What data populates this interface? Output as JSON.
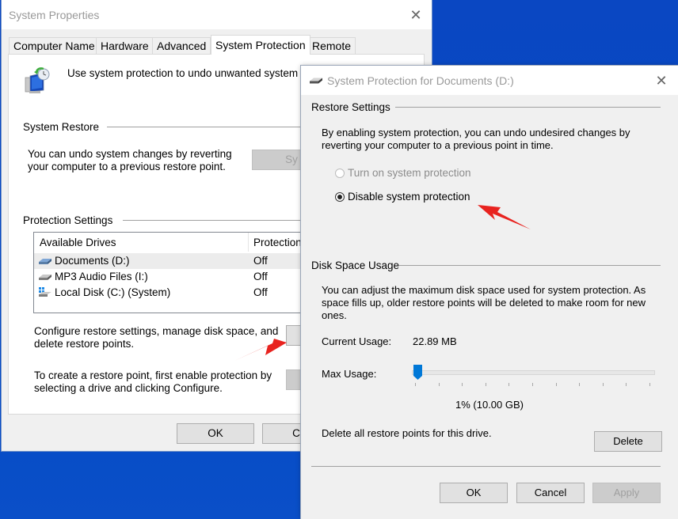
{
  "main_window": {
    "title": "System Properties",
    "close_icon": "close-icon",
    "tabs": [
      {
        "label": "Computer Name",
        "active": false
      },
      {
        "label": "Hardware",
        "active": false
      },
      {
        "label": "Advanced",
        "active": false
      },
      {
        "label": "System Protection",
        "active": true
      },
      {
        "label": "Remote",
        "active": false
      }
    ],
    "intro_icon": "system-restore-icon",
    "intro_text": "Use system protection to undo unwanted system c",
    "system_restore": {
      "group_label": "System Restore",
      "description": "You can undo system changes by reverting your computer to a previous restore point.",
      "button_label": "Sy"
    },
    "protection_settings": {
      "group_label": "Protection Settings",
      "columns": [
        "Available Drives",
        "Protection"
      ],
      "drives": [
        {
          "name": "Documents (D:)",
          "protection": "Off",
          "icon": "drive-icon",
          "selected": true
        },
        {
          "name": "MP3 Audio Files (I:)",
          "protection": "Off",
          "icon": "drive-icon",
          "selected": false
        },
        {
          "name": "Local Disk (C:) (System)",
          "protection": "Off",
          "icon": "system-drive-icon",
          "selected": false
        }
      ],
      "configure_text": "Configure restore settings, manage disk space, and delete restore points.",
      "create_text": "To create a restore point, first enable protection by selecting a drive and clicking Configure."
    },
    "ok_label": "OK",
    "cancel_label": "Car"
  },
  "dialog": {
    "title": "System Protection for Documents (D:)",
    "title_icon": "drive-icon",
    "restore_settings": {
      "group_label": "Restore Settings",
      "description": "By enabling system protection, you can undo undesired changes by reverting your computer to a previous point in time.",
      "options": [
        {
          "label": "Turn on system protection",
          "selected": false,
          "enabled": false
        },
        {
          "label": "Disable system protection",
          "selected": true,
          "enabled": true
        }
      ]
    },
    "disk_space": {
      "group_label": "Disk Space Usage",
      "description": "You can adjust the maximum disk space used for system protection. As space fills up, older restore points will be deleted to make room for new ones.",
      "current_usage_label": "Current Usage:",
      "current_usage_value": "22.89 MB",
      "max_usage_label": "Max Usage:",
      "max_usage_percent": 1,
      "max_usage_text": "1% (10.00 GB)",
      "tick_count": 11,
      "delete_text": "Delete all restore points for this drive.",
      "delete_label": "Delete"
    },
    "ok_label": "OK",
    "cancel_label": "Cancel",
    "apply_label": "Apply"
  },
  "annotations": {
    "arrow_color": "#e8231f"
  },
  "colors": {
    "desktop": "#0349c4",
    "slider_thumb": "#0078d7"
  }
}
